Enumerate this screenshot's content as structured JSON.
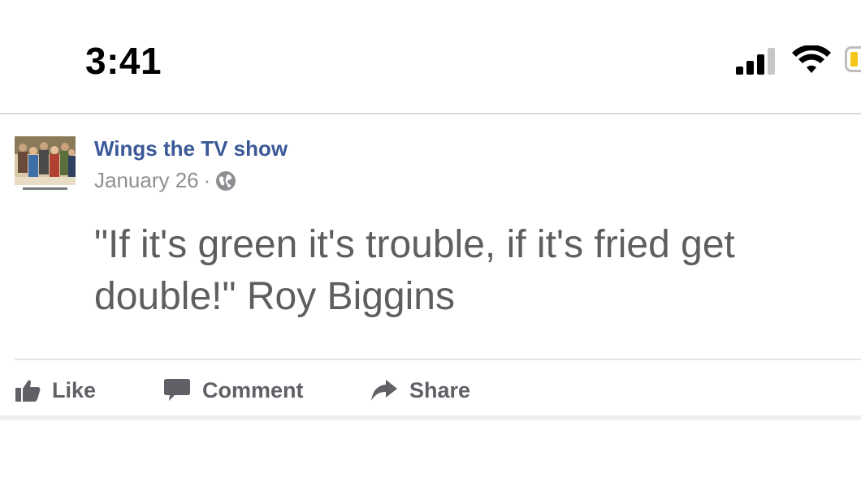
{
  "status_bar": {
    "time": "3:41",
    "icons": [
      "cellular-signal-icon",
      "wifi-icon",
      "battery-icon"
    ],
    "signal_bars_filled": 3,
    "signal_bars_total": 4,
    "battery_color": "#f5c518"
  },
  "post": {
    "page_name": "Wings the TV show",
    "date": "January 26",
    "separator": "·",
    "privacy_icon": "globe-icon",
    "text": "\"If it's green it's trouble, if it's fried get double!\" Roy Biggins"
  },
  "actions": {
    "like": {
      "label": "Like",
      "icon": "thumbs-up-icon"
    },
    "comment": {
      "label": "Comment",
      "icon": "comment-icon"
    },
    "share": {
      "label": "Share",
      "icon": "share-arrow-icon"
    }
  },
  "colors": {
    "page_name": "#3b5998",
    "meta_text": "#8d8f93",
    "post_text": "#5e5e5e",
    "action_text": "#5f6166"
  }
}
